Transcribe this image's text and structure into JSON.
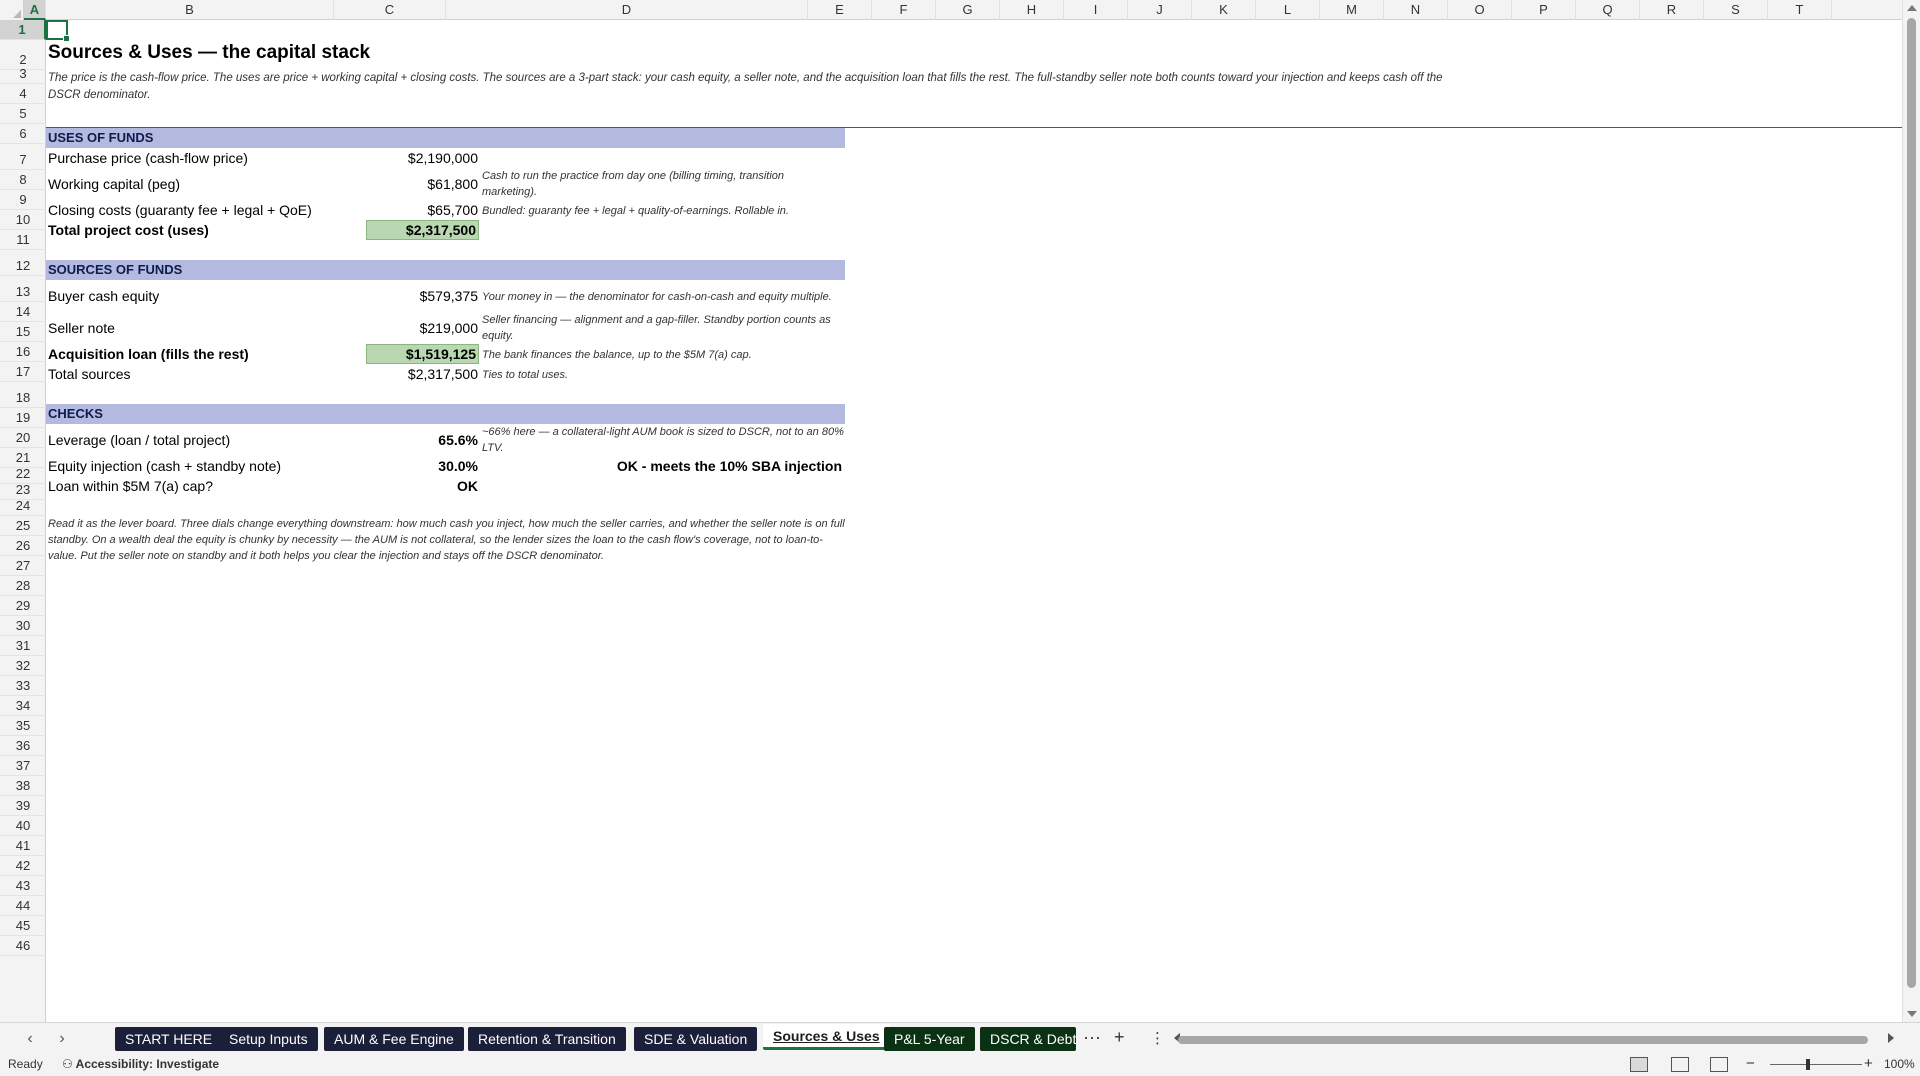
{
  "columns": [
    "A",
    "B",
    "C",
    "D",
    "E",
    "F",
    "G",
    "H",
    "I",
    "J",
    "K",
    "L",
    "M",
    "N",
    "O",
    "P",
    "Q",
    "R",
    "S",
    "T"
  ],
  "rows": [
    "1",
    "2",
    "3",
    "4",
    "5",
    "6",
    "7",
    "8",
    "9",
    "10",
    "11",
    "12",
    "13",
    "14",
    "15",
    "16",
    "17",
    "18",
    "19",
    "20",
    "21",
    "22",
    "23",
    "24",
    "25",
    "26",
    "27",
    "28",
    "29",
    "30",
    "31",
    "32",
    "33",
    "34",
    "35",
    "36",
    "37",
    "38",
    "39",
    "40",
    "41",
    "42",
    "43",
    "44",
    "45",
    "46"
  ],
  "sheet": {
    "title": "Sources & Uses — the capital stack",
    "subtitle": "The price is the cash-flow price. The uses are price + working capital + closing costs. The sources are a 3-part stack: your cash equity, a seller note, and the acquisition loan that fills the rest. The full-standby seller note both counts toward your injection and keeps cash off the DSCR denominator.",
    "uses": {
      "header": "USES OF FUNDS",
      "purchase_label": "Purchase price (cash-flow price)",
      "purchase_value": "$2,190,000",
      "wc_label": "Working capital (peg)",
      "wc_value": "$61,800",
      "wc_note": "Cash to run the practice from day one (billing timing, transition marketing).",
      "closing_label": "Closing costs (guaranty fee + legal + QoE)",
      "closing_value": "$65,700",
      "closing_note": "Bundled: guaranty fee + legal + quality-of-earnings. Rollable in.",
      "total_label": "Total project cost (uses)",
      "total_value": "$2,317,500"
    },
    "sources": {
      "header": "SOURCES OF FUNDS",
      "equity_label": "Buyer cash equity",
      "equity_value": "$579,375",
      "equity_note": "Your money in — the denominator for cash-on-cash and equity multiple.",
      "seller_label": "Seller note",
      "seller_value": "$219,000",
      "seller_note": "Seller financing — alignment and a gap-filler. Standby portion counts as equity.",
      "loan_label": "Acquisition loan (fills the rest)",
      "loan_value": "$1,519,125",
      "loan_note": "The bank finances the balance, up to the $5M 7(a) cap.",
      "total_label": "Total sources",
      "total_value": "$2,317,500",
      "total_note": "Ties to total uses."
    },
    "checks": {
      "header": "CHECKS",
      "leverage_label": "Leverage (loan / total project)",
      "leverage_value": "65.6%",
      "leverage_note": "~66% here — a collateral-light AUM book is sized to DSCR, not to an 80% LTV.",
      "injection_label": "Equity injection (cash + standby note)",
      "injection_value": "30.0%",
      "injection_status": "OK - meets the 10% SBA injection",
      "cap_label": "Loan within $5M 7(a) cap?",
      "cap_value": "OK"
    },
    "footnote": "Read it as the lever board. Three dials change everything downstream: how much cash you inject, how much the seller carries, and whether the seller note is on full standby. On a wealth deal the equity is chunky by necessity — the AUM is not collateral, so the lender sizes the loan to the cash flow's coverage, not to loan-to-value. Put the seller note on standby and it both helps you clear the injection and stays off the DSCR denominator."
  },
  "tabs": [
    {
      "label": "START HERE",
      "style": "navy"
    },
    {
      "label": "Setup Inputs",
      "style": "navy"
    },
    {
      "label": "AUM & Fee Engine",
      "style": "navy"
    },
    {
      "label": "Retention & Transition",
      "style": "navy"
    },
    {
      "label": "SDE & Valuation",
      "style": "navy"
    },
    {
      "label": "Sources & Uses",
      "style": "active"
    },
    {
      "label": "P&L 5-Year",
      "style": "green"
    },
    {
      "label": "DSCR & Debt",
      "style": "green"
    }
  ],
  "tabbar": {
    "more": "···",
    "add": "+",
    "menu": "⋮"
  },
  "status": {
    "ready": "Ready",
    "accessibility": "Accessibility: Investigate",
    "zoom": "100%",
    "zoom_minus": "−",
    "zoom_plus": "+"
  }
}
